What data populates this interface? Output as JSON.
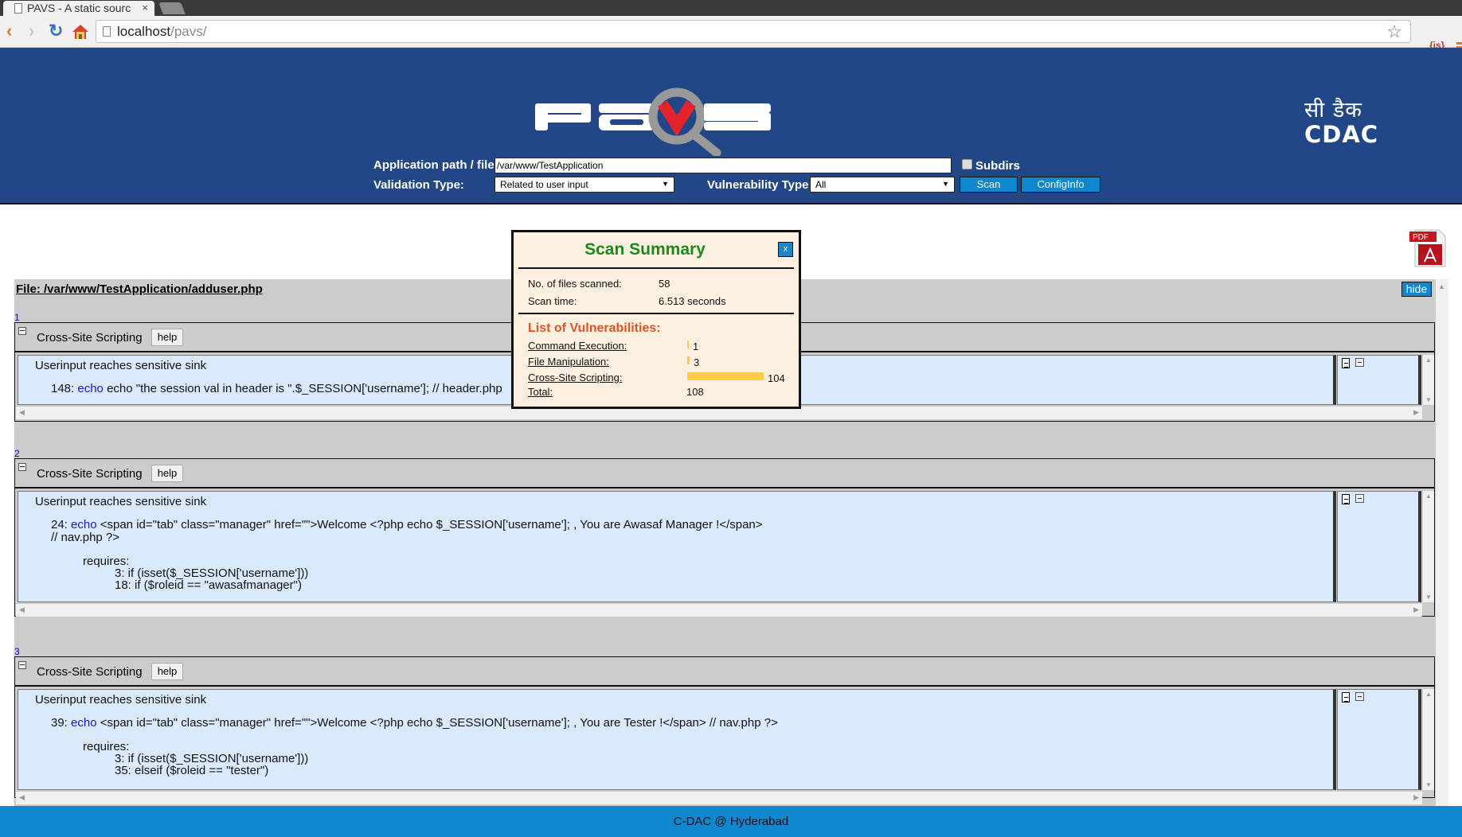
{
  "browser": {
    "tab_title": "PAVS - A static sourc",
    "url_host": "localhost",
    "url_path": "/pavs/"
  },
  "header": {
    "logo_text": "PAVS",
    "org_logo_hindi": "सी डैक",
    "org_logo_latin": "CDAC",
    "form": {
      "path_label": "Application path / file:",
      "path_value": "/var/www/TestApplication",
      "subdirs_label": "Subdirs",
      "subdirs_checked": false,
      "validation_label": "Validation Type:",
      "validation_value": "Related to user input",
      "vuln_type_label": "Vulnerability Type:",
      "vuln_type_value": "All",
      "scan_label": "Scan",
      "configinfo_label": "ConfigInfo"
    }
  },
  "results": {
    "file_title": "File: /var/www/TestApplication/adduser.php",
    "hide_label": "hide",
    "pdf_icon": "pdf-icon",
    "issues": [
      {
        "number": "1",
        "type": "Cross-Site Scripting",
        "help_label": "help",
        "message": "Userinput reaches sensitive sink",
        "line_no": "148:",
        "sink": "echo",
        "code": "echo \"the session val in header is \".$_SESSION['username']; // header.php",
        "code_cont": "",
        "requires_label": "",
        "requires": []
      },
      {
        "number": "2",
        "type": "Cross-Site Scripting",
        "help_label": "help",
        "message": "Userinput reaches sensitive sink",
        "line_no": "24:",
        "sink": "echo",
        "code": "<span id=\"tab\" class=\"manager\" href=\"\">Welcome <?php echo $_SESSION['username']; , You are Awasaf Manager !</span>",
        "code_cont": "// nav.php ?>",
        "requires_label": "requires:",
        "requires": [
          "3: if (isset($_SESSION['username']))",
          "18: if ($roleid == \"awasafmanager\")"
        ]
      },
      {
        "number": "3",
        "type": "Cross-Site Scripting",
        "help_label": "help",
        "message": "Userinput reaches sensitive sink",
        "line_no": "39:",
        "sink": "echo",
        "code": "<span id=\"tab\" class=\"manager\" href=\"\">Welcome <?php echo $_SESSION['username']; , You are Tester !</span> // nav.php ?>",
        "code_cont": "",
        "requires_label": "requires:",
        "requires": [
          "3: if (isset($_SESSION['username']))",
          "35: elseif ($roleid == \"tester\")"
        ]
      }
    ]
  },
  "summary": {
    "title": "Scan Summary",
    "close_label": "x",
    "files_label": "No. of files scanned:",
    "files_value": "58",
    "time_label": "Scan time:",
    "time_value": "6.513 seconds",
    "vuln_heading": "List of Vulnerabilities:",
    "vulns": [
      {
        "label": "Command Execution:",
        "count": 1
      },
      {
        "label": "File Manipulation:",
        "count": 3
      },
      {
        "label": "Cross-Site Scripting:",
        "count": 104
      }
    ],
    "total_label": "Total:",
    "total_value": "108",
    "bar_color": "#fccb4e"
  },
  "footer": {
    "text": "C-DAC @ Hyderabad"
  },
  "colors": {
    "header_bg": "#224787",
    "accent_button": "#0e87cf",
    "summary_title": "#1a8a1a",
    "vuln_heading": "#e05424",
    "code_bg": "#dbe9fc"
  }
}
